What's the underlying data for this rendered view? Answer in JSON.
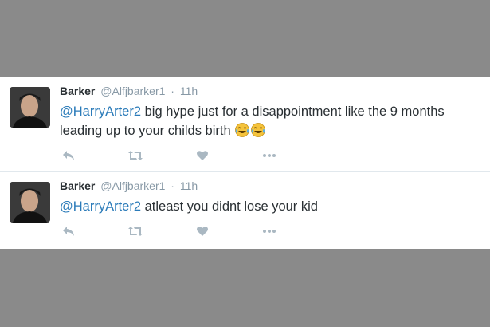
{
  "tweets": [
    {
      "name": "Barker",
      "handle": "@Alfjbarker1",
      "separator": "·",
      "time": "11h",
      "mention": "@HarryArter2",
      "text": " big hype just for a disappointment like the 9 months leading up to your childs birth ",
      "emojis": [
        "face-with-tears-of-joy-icon",
        "face-with-tears-of-joy-icon"
      ]
    },
    {
      "name": "Barker",
      "handle": "@Alfjbarker1",
      "separator": "·",
      "time": "11h",
      "mention": "@HarryArter2",
      "text": " atleast you didnt lose your kid"
    }
  ],
  "actions": [
    "reply-icon",
    "retweet-icon",
    "like-icon",
    "more-icon"
  ],
  "colors": {
    "background": "#8a8a8a",
    "card": "#ffffff",
    "mention": "#2b7bb9",
    "meta": "#8899a6",
    "text": "#292f33",
    "action_icon": "#aab8c2"
  }
}
